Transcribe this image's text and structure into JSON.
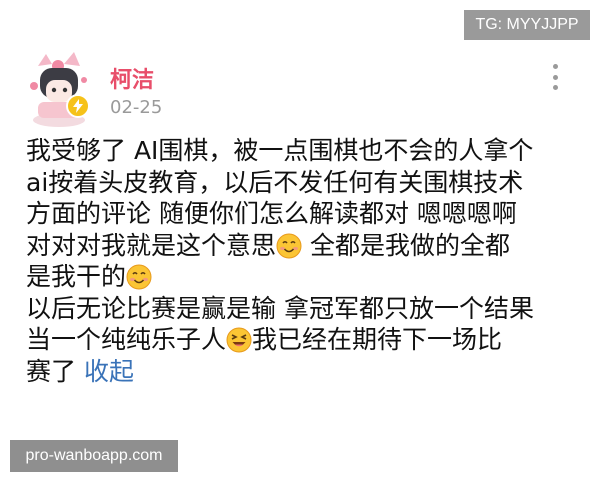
{
  "overlay": {
    "telegram_tag": "TG: MYYJJPP",
    "site_watermark": "pro-wanboapp.com"
  },
  "post": {
    "author": {
      "name": "柯洁",
      "avatar_icon": "cartoon-avatar-icon",
      "badge_icon": "lightning-verified-icon"
    },
    "date": "02-25",
    "more_icon": "vertical-ellipsis-icon",
    "body": {
      "line1": "我受够了 AI围棋，被一点围棋也不会的人拿个",
      "line2": "ai按着头皮教育，以后不发任何有关围棋技术",
      "line3": "方面的评论 随便你们怎么解读都对 嗯嗯嗯啊",
      "line4_a": "对对对我就是这个意思",
      "line4_b": " 全都是我做的全都",
      "line5": "是我干的",
      "line6": "以后无论比赛是赢是输 拿冠军都只放一个结果",
      "line7_a": "当一个纯纯乐子人",
      "line7_b": "我已经在期待下一场比",
      "line8": "赛了 ",
      "collapse_label": "收起"
    },
    "emoji_icons": [
      "smile-emoji-icon",
      "smile-emoji-icon",
      "laughing-emoji-icon"
    ],
    "colors": {
      "name": "#e84e6a",
      "link": "#3a73b8",
      "date": "#9a9a9a"
    }
  }
}
